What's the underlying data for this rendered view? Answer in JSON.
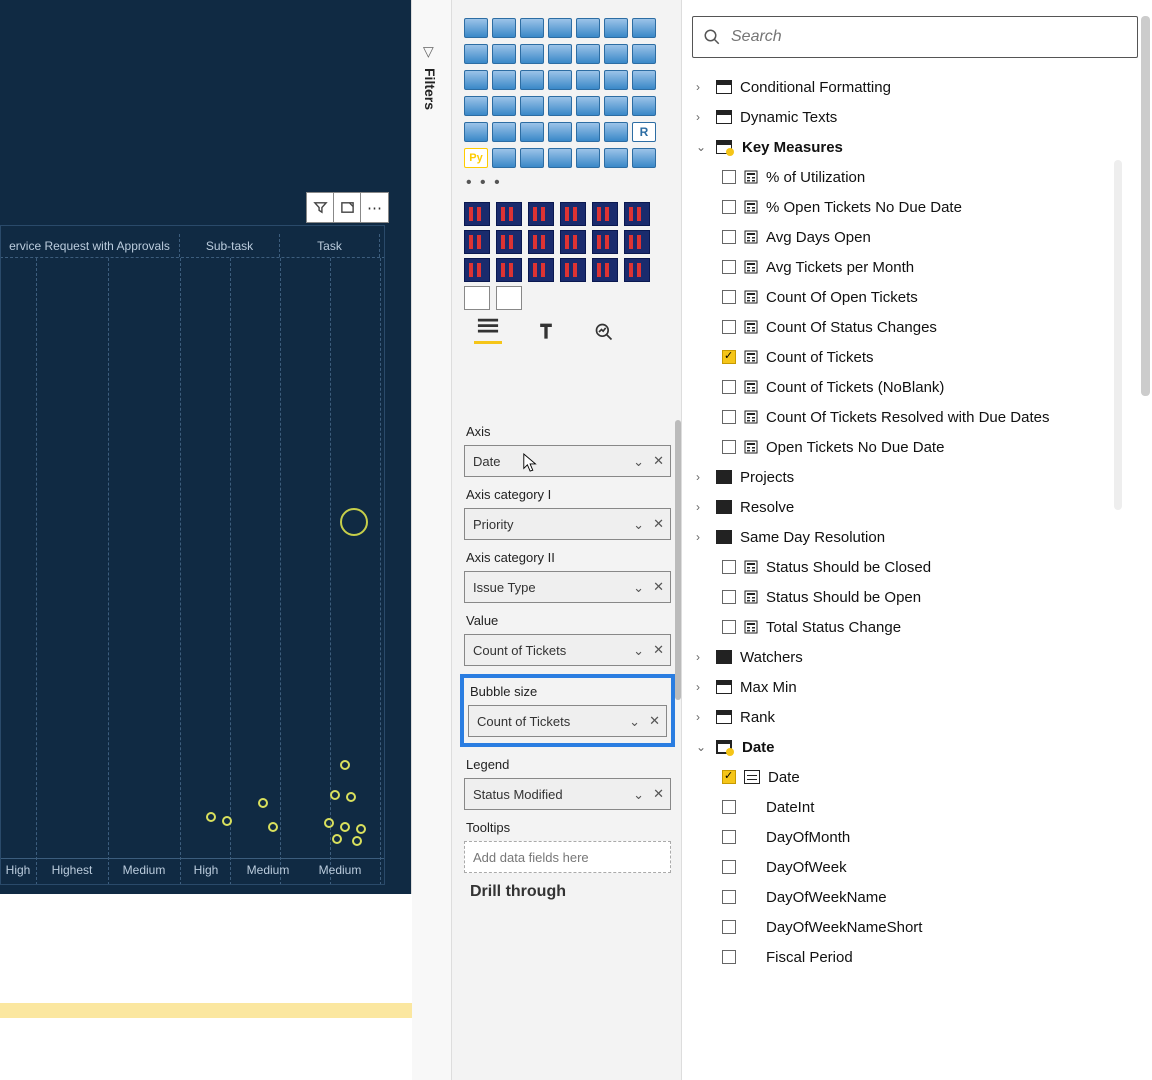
{
  "filters": {
    "label": "Filters"
  },
  "canvas": {
    "toolbar": {
      "filter": "⧉",
      "focus": "⛶",
      "more": "⋯"
    },
    "headers": [
      "ervice Request with Approvals",
      "Sub-task",
      "Task"
    ],
    "footers": [
      "High",
      "Highest",
      "Medium",
      "High",
      "Medium",
      "Medium"
    ]
  },
  "viz": {
    "r_label": "R",
    "py_label": "Py",
    "ellipsis": "• • •",
    "wells": {
      "axis": {
        "label": "Axis",
        "value": "Date"
      },
      "cat1": {
        "label": "Axis category I",
        "value": "Priority"
      },
      "cat2": {
        "label": "Axis category II",
        "value": "Issue Type"
      },
      "value": {
        "label": "Value",
        "value": "Count of Tickets"
      },
      "bubble": {
        "label": "Bubble size",
        "value": "Count of Tickets"
      },
      "legend": {
        "label": "Legend",
        "value": "Status Modified"
      },
      "tooltips": {
        "label": "Tooltips",
        "placeholder": "Add data fields here"
      }
    },
    "drill": "Drill through"
  },
  "search": {
    "placeholder": "Search"
  },
  "fields": {
    "tables": [
      {
        "name": "Conditional Formatting",
        "expanded": false,
        "icon": "table"
      },
      {
        "name": "Dynamic Texts",
        "expanded": false,
        "icon": "table"
      },
      {
        "name": "Key Measures",
        "expanded": true,
        "icon": "table",
        "highlight": true,
        "children": [
          {
            "name": "% of Utilization",
            "type": "measure",
            "checked": false
          },
          {
            "name": "% Open Tickets No Due Date",
            "type": "measure",
            "checked": false
          },
          {
            "name": "Avg Days Open",
            "type": "measure",
            "checked": false
          },
          {
            "name": "Avg Tickets per Month",
            "type": "measure",
            "checked": false
          },
          {
            "name": "Count Of Open Tickets",
            "type": "measure",
            "checked": false
          },
          {
            "name": "Count Of Status Changes",
            "type": "measure",
            "checked": false
          },
          {
            "name": "Count of Tickets",
            "type": "measure",
            "checked": true
          },
          {
            "name": "Count of Tickets (NoBlank)",
            "type": "measure",
            "checked": false
          },
          {
            "name": "Count Of Tickets Resolved with Due Dates",
            "type": "measure",
            "checked": false
          },
          {
            "name": "Open Tickets No Due Date",
            "type": "measure",
            "checked": false
          }
        ]
      },
      {
        "name": "Projects",
        "expanded": false,
        "icon": "solidtable"
      },
      {
        "name": "Resolve",
        "expanded": false,
        "icon": "solidtable"
      },
      {
        "name": "Same Day Resolution",
        "expanded": false,
        "icon": "solidtable",
        "children_collapsed": [
          {
            "name": "Status Should be Closed",
            "type": "measure",
            "checked": false
          },
          {
            "name": "Status Should be Open",
            "type": "measure",
            "checked": false
          },
          {
            "name": "Total Status Change",
            "type": "measure",
            "checked": false
          }
        ]
      },
      {
        "name": "Watchers",
        "expanded": false,
        "icon": "solidtable"
      },
      {
        "name": "Max Min",
        "expanded": false,
        "icon": "table"
      },
      {
        "name": "Rank",
        "expanded": false,
        "icon": "table"
      },
      {
        "name": "Date",
        "expanded": true,
        "icon": "datetable",
        "highlight": true,
        "children": [
          {
            "name": "Date",
            "type": "hierarchy",
            "checked": true
          },
          {
            "name": "DateInt",
            "type": "column",
            "checked": false
          },
          {
            "name": "DayOfMonth",
            "type": "column",
            "checked": false
          },
          {
            "name": "DayOfWeek",
            "type": "column",
            "checked": false
          },
          {
            "name": "DayOfWeekName",
            "type": "column",
            "checked": false
          },
          {
            "name": "DayOfWeekNameShort",
            "type": "column",
            "checked": false
          },
          {
            "name": "Fiscal Period",
            "type": "column",
            "checked": false
          }
        ]
      }
    ]
  }
}
